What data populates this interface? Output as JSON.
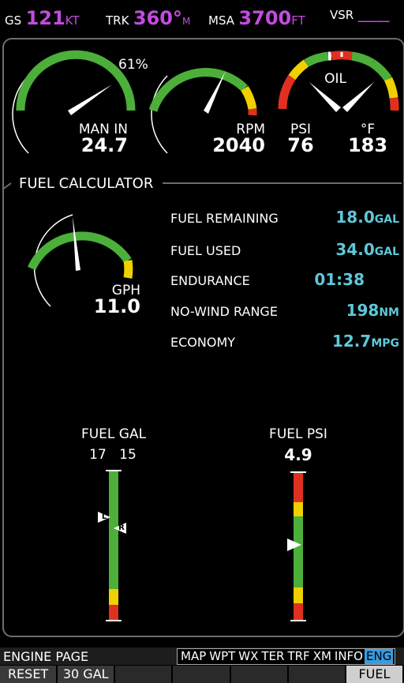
{
  "top_bar": {
    "gs": {
      "label": "GS",
      "value": "121",
      "unit": "KT"
    },
    "trk": {
      "label": "TRK",
      "value": "360°",
      "unit": "M"
    },
    "msa": {
      "label": "MSA",
      "value": "3700",
      "unit": "FT"
    },
    "vsr": {
      "label": "VSR",
      "value": "_____"
    }
  },
  "gauges": {
    "manifold": {
      "pct_label": "61%",
      "label": "MAN IN",
      "value": "24.7"
    },
    "rpm": {
      "label": "RPM",
      "value": "2040"
    },
    "oil": {
      "title": "OIL",
      "psi_label": "PSI",
      "psi_value": "76",
      "temp_label": "°F",
      "temp_value": "183"
    }
  },
  "fuel_calculator": {
    "title": "FUEL CALCULATOR",
    "gph_label": "GPH",
    "gph_value": "11.0",
    "rows": [
      {
        "label": "FUEL REMAINING",
        "value": "18.0",
        "unit": "GAL"
      },
      {
        "label": "FUEL USED",
        "value": "34.0",
        "unit": "GAL"
      },
      {
        "label": "ENDURANCE",
        "value": "01:38",
        "unit": ""
      },
      {
        "label": "NO-WIND RANGE",
        "value": "198",
        "unit": "NM"
      },
      {
        "label": "ECONOMY",
        "value": "12.7",
        "unit": "MPG"
      }
    ]
  },
  "fuel_gal": {
    "title": "FUEL GAL",
    "left_value": "17",
    "right_value": "15",
    "left_marker": "L",
    "right_marker": "R"
  },
  "fuel_psi": {
    "title": "FUEL PSI",
    "value": "4.9"
  },
  "status": {
    "page_label": "ENGINE PAGE",
    "tabs": [
      "MAP",
      "WPT",
      "WX",
      "TER",
      "TRF",
      "XM",
      "INFO",
      "ENG"
    ],
    "active_tab": "ENG"
  },
  "softkeys": [
    "RESET",
    "30 GAL",
    "",
    "",
    "",
    "",
    "FUEL"
  ],
  "colors": {
    "accent_magenta": "#c34be0",
    "cyan": "#5ec8d8",
    "green": "#4caf3a",
    "yellow": "#f0d000",
    "red": "#e03020"
  }
}
